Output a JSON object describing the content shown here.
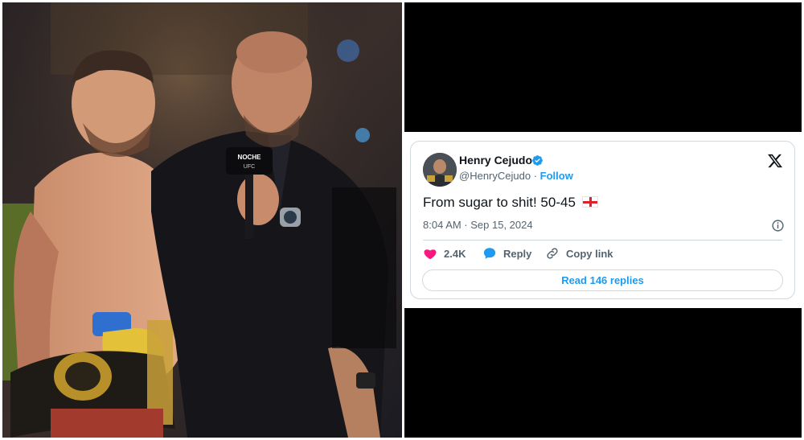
{
  "photo": {
    "description_icons": [
      "microphone-icon",
      "watch-icon",
      "championship-belt-icon"
    ],
    "mic_text_top": "NOCHE",
    "mic_text_bottom": "UFC"
  },
  "tweet": {
    "display_name": "Henry Cejudo",
    "handle": "@HenryCejudo",
    "separator": "·",
    "follow_label": "Follow",
    "text": "From sugar to shit! 50-45",
    "time": "8:04 AM · Sep 15, 2024",
    "likes": "2.4K",
    "reply_label": "Reply",
    "copy_label": "Copy link",
    "read_replies_label": "Read 146 replies",
    "accent_color": "#1d9bf0",
    "like_color": "#f91880"
  }
}
